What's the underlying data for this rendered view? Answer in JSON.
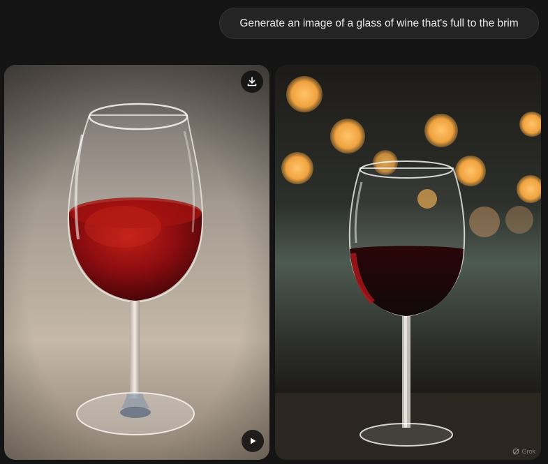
{
  "prompt": {
    "text": "Generate an image of a glass of wine that's full to the brim"
  },
  "images": [
    {
      "subject": "glass-of-red-wine-on-linen",
      "actions": {
        "download_icon": "download-icon",
        "play_icon": "play-icon"
      }
    },
    {
      "subject": "glass-of-red-wine-bokeh-background",
      "watermark": {
        "label": "Grok",
        "icon": "grok-logo-icon"
      }
    }
  ],
  "colors": {
    "page_bg": "#141414",
    "bubble_bg": "#242424",
    "wine": "#7a0d12"
  }
}
